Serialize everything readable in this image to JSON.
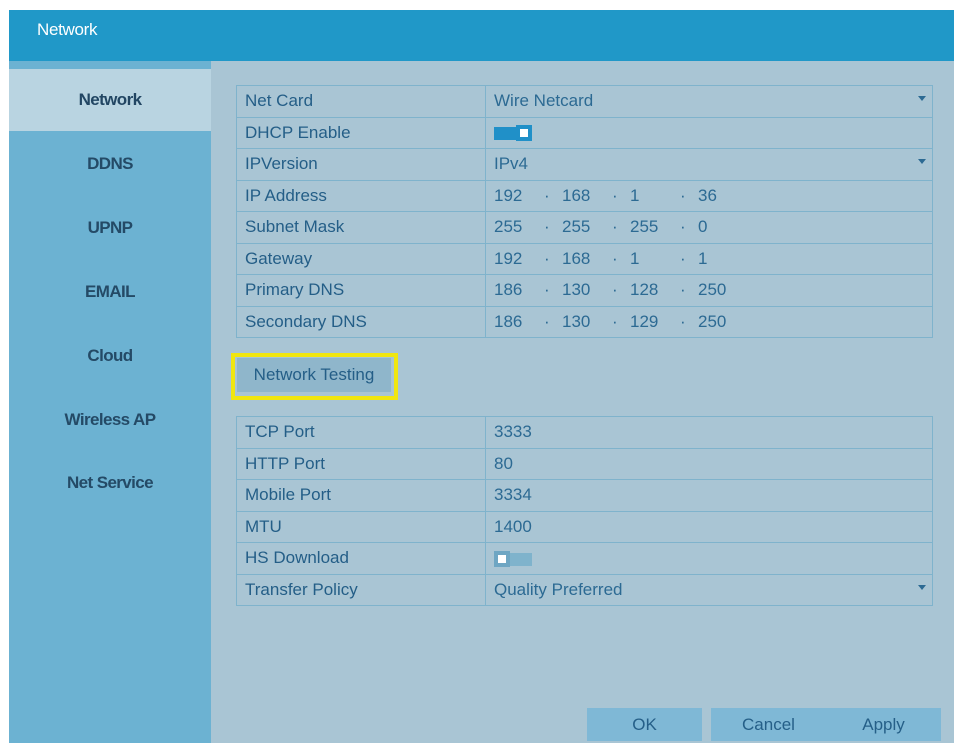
{
  "window": {
    "title": "Network"
  },
  "sidebar": {
    "items": [
      {
        "label": "Network",
        "active": true
      },
      {
        "label": "DDNS"
      },
      {
        "label": "UPNP"
      },
      {
        "label": "EMAIL"
      },
      {
        "label": "Cloud"
      },
      {
        "label": "Wireless AP"
      },
      {
        "label": "Net Service"
      }
    ]
  },
  "network": {
    "net_card": {
      "label": "Net Card",
      "value": "Wire Netcard"
    },
    "dhcp": {
      "label": "DHCP Enable",
      "state": "on"
    },
    "ip_version": {
      "label": "IPVersion",
      "value": "IPv4"
    },
    "ip_address": {
      "label": "IP Address",
      "octets": [
        "192",
        "168",
        "1",
        "36"
      ]
    },
    "subnet_mask": {
      "label": "Subnet Mask",
      "octets": [
        "255",
        "255",
        "255",
        "0"
      ]
    },
    "gateway": {
      "label": "Gateway",
      "octets": [
        "192",
        "168",
        "1",
        "1"
      ]
    },
    "primary_dns": {
      "label": "Primary DNS",
      "octets": [
        "186",
        "130",
        "128",
        "250"
      ]
    },
    "secondary_dns": {
      "label": "Secondary DNS",
      "octets": [
        "186",
        "130",
        "129",
        "250"
      ]
    },
    "separator": "·"
  },
  "testing_button": "Network Testing",
  "ports": {
    "tcp": {
      "label": "TCP Port",
      "value": "3333"
    },
    "http": {
      "label": "HTTP Port",
      "value": "80"
    },
    "mobile": {
      "label": "Mobile Port",
      "value": "3334"
    },
    "mtu": {
      "label": "MTU",
      "value": "1400"
    },
    "hs_download": {
      "label": "HS Download",
      "state": "off"
    },
    "transfer_policy": {
      "label": "Transfer Policy",
      "value": "Quality Preferred"
    }
  },
  "buttons": {
    "ok": "OK",
    "cancel": "Cancel",
    "apply": "Apply"
  },
  "colors": {
    "title_bar": "#2098c8",
    "sidebar": "#6cb2d2",
    "panel": "#a9c5d4",
    "highlight": "#f0e60f"
  }
}
